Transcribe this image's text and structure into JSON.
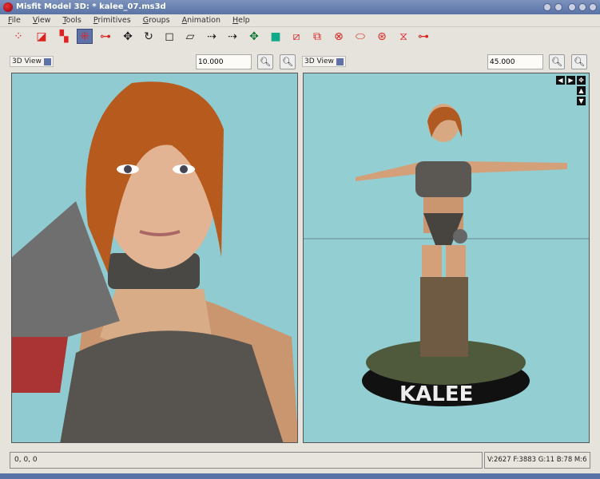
{
  "window": {
    "title": "Misfit Model 3D: * kalee_07.ms3d"
  },
  "menu": [
    {
      "k": "F",
      "r": "ile"
    },
    {
      "k": "V",
      "r": "iew"
    },
    {
      "k": "T",
      "r": "ools"
    },
    {
      "k": "P",
      "r": "rimitives"
    },
    {
      "k": "G",
      "r": "roups"
    },
    {
      "k": "A",
      "r": "nimation"
    },
    {
      "k": "H",
      "r": "elp"
    }
  ],
  "toolbar": [
    "select-vertices",
    "select-faces",
    "select-connected",
    "select-groups",
    "select-bones",
    "move",
    "rotate",
    "scale",
    "shear",
    "extrude",
    "attach",
    "drag-vertex",
    "apply-projection",
    "rectangle",
    "cube",
    "ellipsoid",
    "cylinder",
    "torus",
    "polygon",
    "joint"
  ],
  "left_view": {
    "mode": "3D View",
    "zoom": "10.000"
  },
  "right_view": {
    "mode": "3D View",
    "zoom": "45.000"
  },
  "model": {
    "base_text": "KALEE"
  },
  "status": {
    "coords": "0, 0, 0",
    "stats": "V:2627 F:3883 G:11 B:78 M:6"
  }
}
